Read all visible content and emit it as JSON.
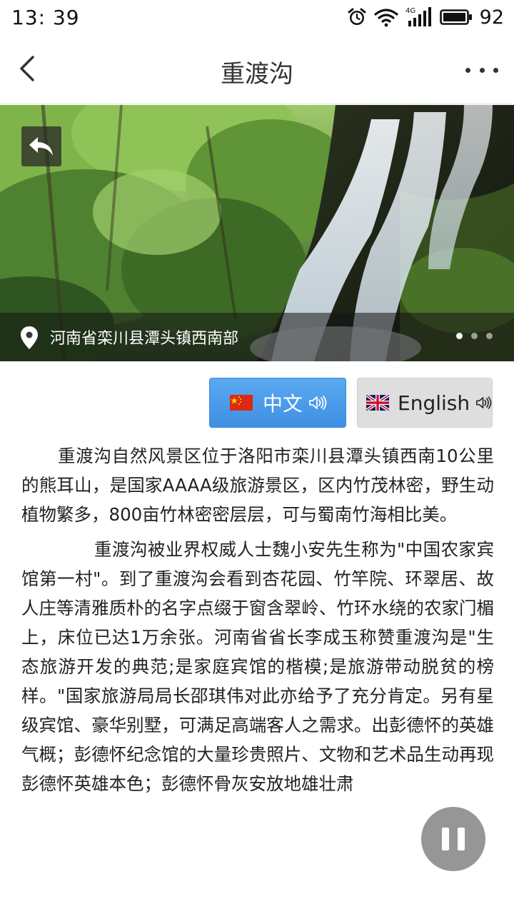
{
  "status_bar": {
    "time": "13: 39",
    "battery": "92",
    "network": "4G",
    "icons": [
      "alarm-icon",
      "wifi-icon",
      "signal-4g-icon",
      "battery-icon"
    ]
  },
  "header": {
    "title": "重渡沟",
    "back_icon": "chevron-left-icon",
    "more_icon": "more-dots-icon"
  },
  "hero": {
    "location": "河南省栾川县潭头镇西南部",
    "back_icon": "reply-arrow-icon",
    "pin_icon": "location-pin-icon",
    "slides_total": 3,
    "slide_active": 1
  },
  "language": {
    "chinese_label": "中文",
    "english_label": "English",
    "selected": "chinese",
    "selected_color": "#4a9bea",
    "unselected_color": "#dedede"
  },
  "article": {
    "paragraphs": [
      "重渡沟自然风景区位于洛阳市栾川县潭头镇西南10公里的熊耳山，是国家AAAA级旅游景区，区内竹茂林密，野生动植物繁多，800亩竹林密密层层，可与蜀南竹海相比美。",
      "重渡沟被业界权威人士魏小安先生称为\"中国农家宾馆第一村\"。到了重渡沟会看到杏花园、竹竿院、环翠居、故人庄等清雅质朴的名字点缀于窗含翠岭、竹环水绕的农家门楣上，床位已达1万余张。河南省省长李成玉称赞重渡沟是\"生态旅游开发的典范;是家庭宾馆的楷模;是旅游带动脱贫的榜样。\"国家旅游局局长邵琪伟对此亦给予了充分肯定。另有星级宾馆、豪华别墅，可满足高端客人之需求。出彭德怀的英雄气概；彭德怀纪念馆的大量珍贵照片、文物和艺术品生动再现彭德怀英雄本色；彭德怀骨灰安放地雄壮肃"
    ]
  },
  "player": {
    "pause_icon": "pause-icon"
  }
}
